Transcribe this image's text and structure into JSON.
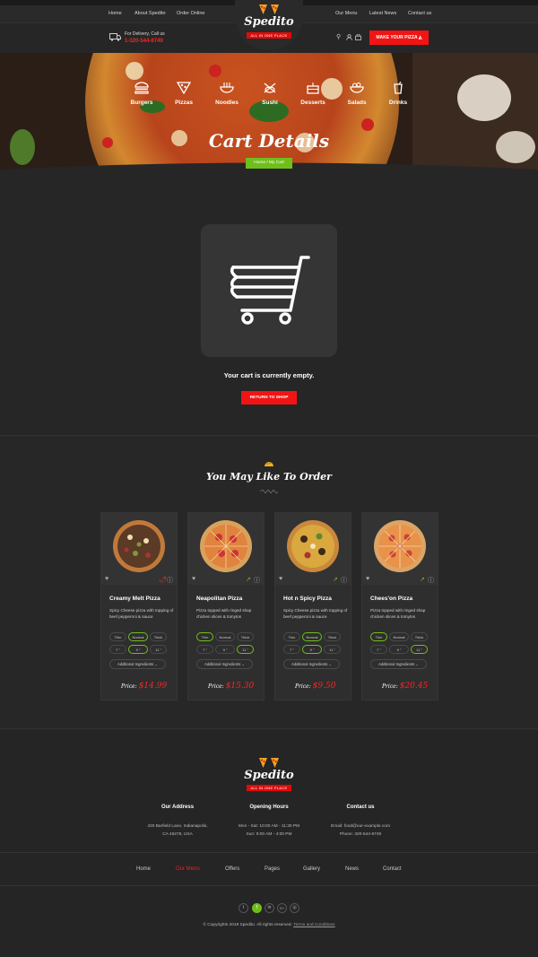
{
  "nav": {
    "left": [
      "Home",
      "About Spedito",
      "Order Online"
    ],
    "right": [
      "Our Menu",
      "Latest News",
      "Contact us"
    ]
  },
  "brand": {
    "name": "Spedito",
    "tagline": "ALL IN ONE PLACE"
  },
  "delivery": {
    "label": "For Delivery, Call us",
    "phone": "1-320-544-8749"
  },
  "header_button": "MAKE YOUR PIZZA",
  "categories": [
    "Burgers",
    "Pizzas",
    "Noodles",
    "Sushi",
    "Desserts",
    "Salads",
    "Drinks"
  ],
  "page_title": "Cart Details",
  "breadcrumb": {
    "home": "Home",
    "sep": "/",
    "current": "My Cart"
  },
  "cart": {
    "empty_text": "Your cart is currently empty.",
    "button": "RETURN TO SHOP"
  },
  "section_title": "You May Like To Order",
  "products": [
    {
      "name": "Creamy Melt Pizza",
      "desc": "Spicy Cheese pizza with topping of beef pepperoni & sauce",
      "crust": [
        "Thin",
        "Normal",
        "Thick"
      ],
      "sizes": [
        "7 \"",
        "9 \"",
        "11 \""
      ],
      "sel_crust": 1,
      "sel_size": 1,
      "addons": "Additional Ingredients",
      "price_label": "Price:",
      "price": "$14.99"
    },
    {
      "name": "Neapolitan Pizza",
      "desc": "Pizza topped with ringed shap chicken slices & tomytos",
      "crust": [
        "Thin",
        "Normal",
        "Thick"
      ],
      "sizes": [
        "7 \"",
        "9 \"",
        "11 \""
      ],
      "sel_crust": 0,
      "sel_size": 2,
      "addons": "Additional Ingredients",
      "price_label": "Price:",
      "price": "$15.30"
    },
    {
      "name": "Hot n Spicy Pizza",
      "desc": "Spicy Cheese pizza with topping of beef pepperoni & sauce",
      "crust": [
        "Thin",
        "Normal",
        "Thick"
      ],
      "sizes": [
        "7 \"",
        "9 \"",
        "11 \""
      ],
      "sel_crust": 1,
      "sel_size": 1,
      "addons": "Additional Ingredients",
      "price_label": "Price:",
      "price": "$9.50"
    },
    {
      "name": "Chees'on Pizza",
      "desc": "Pizza topped with ringed shap chicken slices & tomytos",
      "crust": [
        "Thin",
        "Normal",
        "Thick"
      ],
      "sizes": [
        "7 \"",
        "9 \"",
        "11 \""
      ],
      "sel_crust": 0,
      "sel_size": 2,
      "addons": "Additional Ingredients",
      "price_label": "Price:",
      "price": "$20.45"
    }
  ],
  "footer": {
    "address": {
      "title": "Our Address",
      "lines": [
        "430 Barfield Lane, Indianapolis,",
        "CA 46278, USA"
      ]
    },
    "hours": {
      "title": "Opening Hours",
      "lines": [
        "Mon - Sat: 10:00 AM - 11:30 PM",
        "Sun: 9:00 AM - 4:00 PM"
      ]
    },
    "contact": {
      "title": "Contact us",
      "lines": [
        "Email: food@our-example.com",
        "Phone: 320-544-8749"
      ]
    },
    "nav": [
      "Home",
      "Our Menu",
      "Offers",
      "Pages",
      "Gallery",
      "News",
      "Contact"
    ],
    "social": [
      "t",
      "f",
      "in",
      "G+",
      "◎"
    ],
    "copyright": "© Copyrights 2019 Spedito. All rights reserved.",
    "terms": "Terms and Conditions"
  },
  "colors": {
    "accent_red": "#f21414",
    "accent_green": "#6fbf1b",
    "bg": "#232323"
  }
}
